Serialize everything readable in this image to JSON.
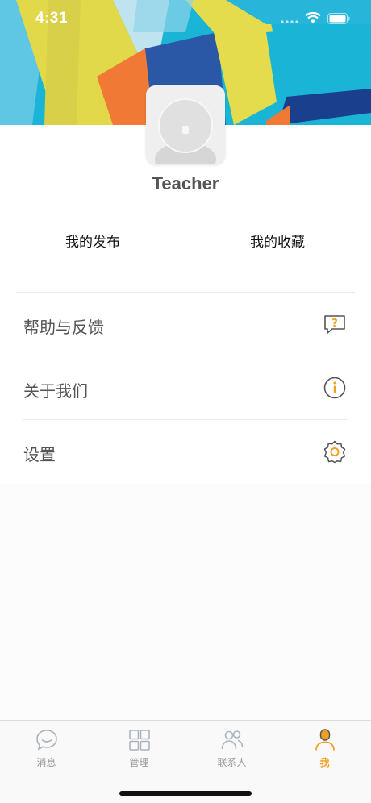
{
  "status_bar": {
    "time": "4:31"
  },
  "profile": {
    "username": "Teacher"
  },
  "quick_links": {
    "my_posts": "我的发布",
    "my_favorites": "我的收藏"
  },
  "menu": {
    "items": [
      {
        "label": "帮助与反馈",
        "icon": "help-feedback-icon"
      },
      {
        "label": "关于我们",
        "icon": "info-icon"
      },
      {
        "label": "设置",
        "icon": "settings-icon"
      }
    ]
  },
  "tabbar": {
    "tabs": [
      {
        "label": "消息",
        "icon": "message-icon",
        "active": false
      },
      {
        "label": "管理",
        "icon": "grid-icon",
        "active": false
      },
      {
        "label": "联系人",
        "icon": "contacts-icon",
        "active": false
      },
      {
        "label": "我",
        "icon": "person-icon",
        "active": true
      }
    ]
  },
  "colors": {
    "accent": "#f0a020",
    "header_blue": "#1ab5d6",
    "header_yellow": "#e2d94a",
    "header_orange": "#f07a35"
  }
}
